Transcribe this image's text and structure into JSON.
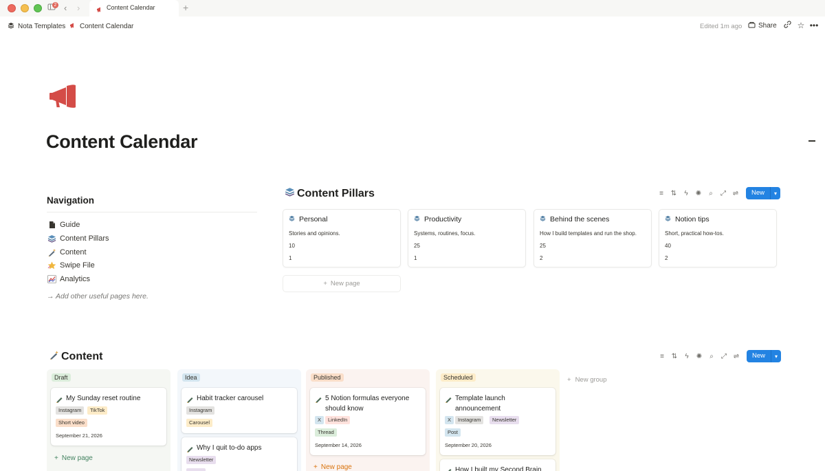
{
  "window": {
    "tab_title": "Content Calendar",
    "notification_count": "2"
  },
  "breadcrumb": {
    "workspace": "Nota Templates",
    "page": "Content Calendar"
  },
  "header_actions": {
    "edited": "Edited 1m ago",
    "share": "Share"
  },
  "page": {
    "title": "Content Calendar",
    "icon": "megaphone-icon"
  },
  "navigation": {
    "heading": "Navigation",
    "items": [
      {
        "label": "Guide",
        "icon": "document-icon"
      },
      {
        "label": "Content Pillars",
        "icon": "layers-icon"
      },
      {
        "label": "Content",
        "icon": "pencil-sparkle-icon"
      },
      {
        "label": "Swipe File",
        "icon": "star-icon"
      },
      {
        "label": "Analytics",
        "icon": "chart-icon"
      }
    ],
    "hint": "→ Add other useful pages here."
  },
  "pillars_db": {
    "title": "Content Pillars",
    "new_label": "New",
    "new_page_label": "New page",
    "cards": [
      {
        "title": "Personal",
        "description": "Stories and opinions.",
        "count_a": "10",
        "count_b": "1"
      },
      {
        "title": "Productivity",
        "description": "Systems, routines, focus.",
        "count_a": "25",
        "count_b": "1"
      },
      {
        "title": "Behind the scenes",
        "description": "How I build templates and run the shop.",
        "count_a": "25",
        "count_b": "2"
      },
      {
        "title": "Notion tips",
        "description": "Short, practical how-tos.",
        "count_a": "40",
        "count_b": "2"
      }
    ]
  },
  "content_db": {
    "title": "Content",
    "new_label": "New",
    "new_group_label": "New group",
    "new_page_label": "New page",
    "columns": [
      {
        "status": "Draft",
        "color": "#dbeddb",
        "cards": [
          {
            "title": "My Sunday reset routine",
            "tags": [
              "Instagram",
              "TikTok",
              "Short video"
            ],
            "date": "September 21, 2026"
          }
        ]
      },
      {
        "status": "Idea",
        "color": "#d3e5ef",
        "cards": [
          {
            "title": "Habit tracker carousel",
            "tags": [
              "Instagram",
              "Carousel"
            ]
          },
          {
            "title": "Why I quit to-do apps",
            "tags": [
              "Newsletter"
            ]
          }
        ]
      },
      {
        "status": "Published",
        "color": "#fadec9",
        "cards": [
          {
            "title": "5 Notion formulas everyone should know",
            "tags": [
              "X",
              "LinkedIn",
              "Thread"
            ],
            "date": "September 14, 2026"
          }
        ]
      },
      {
        "status": "Scheduled",
        "color": "#fdecc8",
        "cards": [
          {
            "title": "Template launch announcement",
            "tags": [
              "X",
              "Instagram",
              "Newsletter",
              "Post"
            ],
            "date": "September 20, 2026"
          },
          {
            "title": "How I built my Second Brain"
          }
        ]
      }
    ]
  }
}
